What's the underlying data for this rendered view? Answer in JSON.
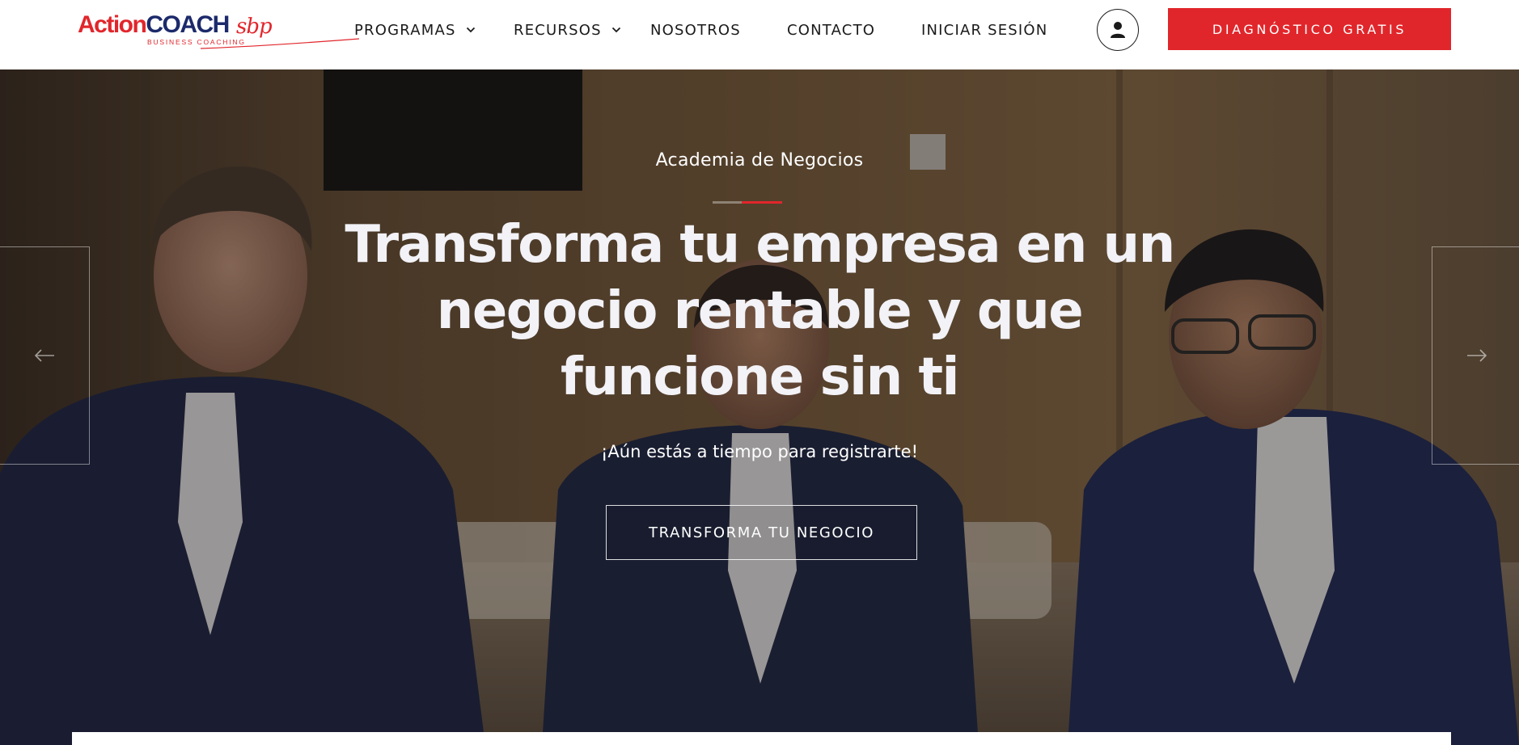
{
  "header": {
    "logo": {
      "action": "Action",
      "coach": "COACH",
      "script": "sbp",
      "subtitle": "BUSINESS COACHING"
    },
    "nav": [
      {
        "label": "PROGRAMAS",
        "has_dropdown": true
      },
      {
        "label": "RECURSOS",
        "has_dropdown": true
      },
      {
        "label": "NOSOTROS",
        "has_dropdown": false
      },
      {
        "label": "CONTACTO",
        "has_dropdown": false
      },
      {
        "label": "INICIAR SESIÓN",
        "has_dropdown": false
      }
    ],
    "user_icon": "user-icon",
    "cta_label": "DIAGNÓSTICO GRATIS"
  },
  "hero": {
    "eyebrow": "Academia de Negocios",
    "headline_lines": [
      "Transforma tu empresa en un",
      "negocio rentable y que",
      "funcione sin ti"
    ],
    "subline": "¡Aún estás a tiempo para registrarte!",
    "cta_label": "TRANSFORMA TU NEGOCIO",
    "prev_icon": "arrow-left-icon",
    "next_icon": "arrow-right-icon"
  },
  "colors": {
    "brand_red": "#e1262b",
    "brand_navy": "#1c2a6b",
    "nav_text": "#1a1a1a",
    "hero_text": "#ffffff"
  }
}
